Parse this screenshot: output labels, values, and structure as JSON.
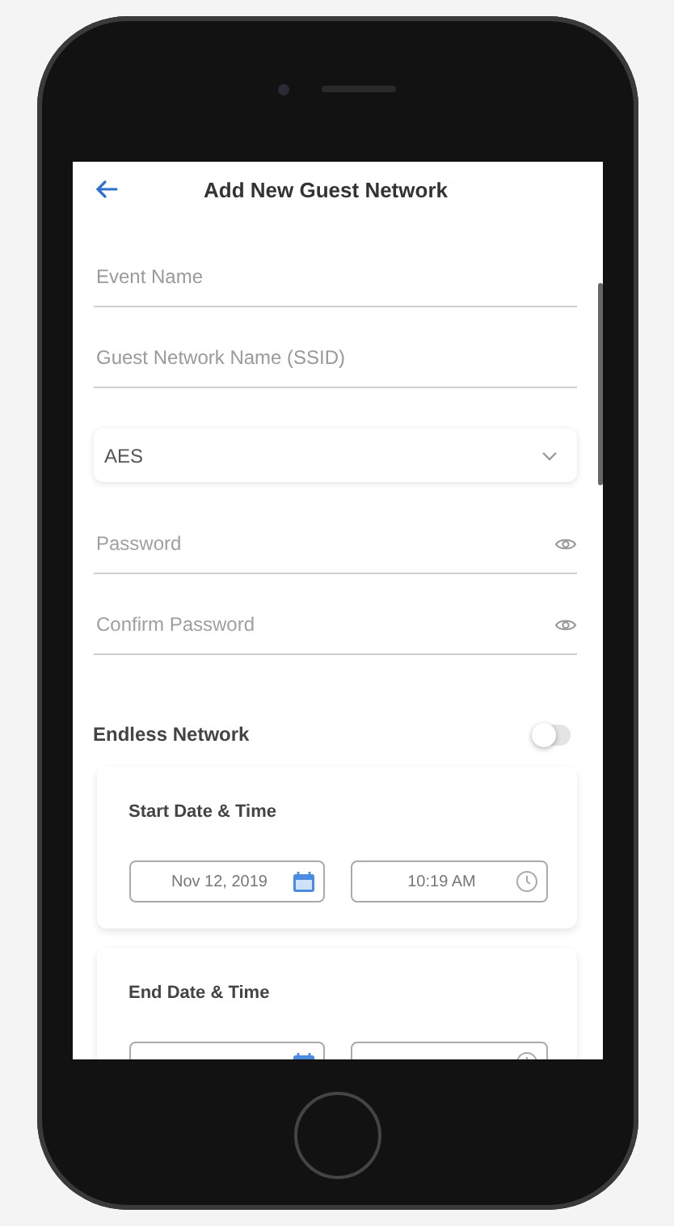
{
  "header": {
    "title": "Add New Guest Network"
  },
  "fields": [
    {
      "kind": "text",
      "placeholder": "Event Name"
    },
    {
      "kind": "text",
      "placeholder": "Guest Network Name (SSID)"
    },
    {
      "kind": "select",
      "value": "AES"
    },
    {
      "kind": "password",
      "placeholder": "Password"
    },
    {
      "kind": "password",
      "placeholder": "Confirm Password"
    }
  ],
  "endless_network": {
    "label": "Endless Network",
    "on": false
  },
  "schedule": [
    {
      "label": "Start Date & Time",
      "date": "Nov 12, 2019",
      "time": "10:19 AM"
    },
    {
      "label": "End Date & Time"
    }
  ]
}
